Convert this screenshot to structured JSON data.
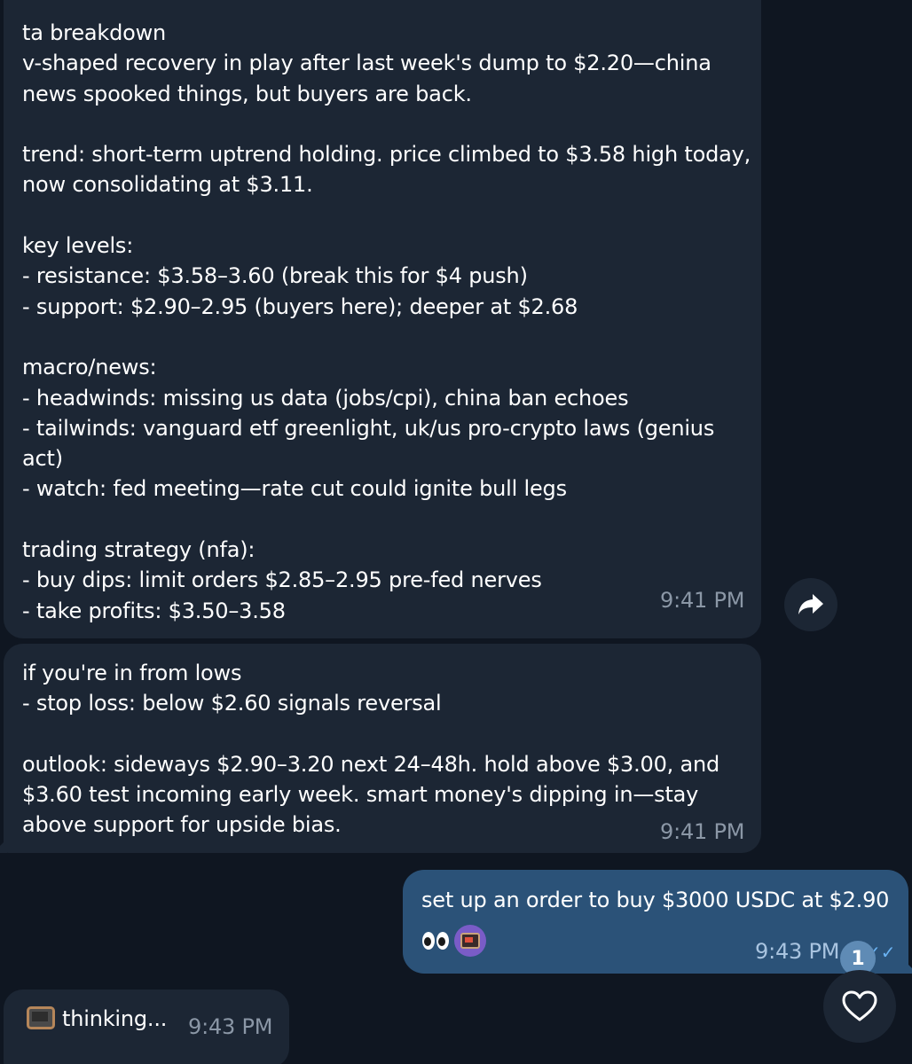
{
  "messages": [
    {
      "text": "ta breakdown\nv-shaped recovery in play after last week's dump to $2.20—china\nnews spooked things, but buyers are back.\n\ntrend: short-term uptrend holding. price climbed to $3.58 high today,\nnow consolidating at $3.11.\n\nkey levels:\n- resistance: $3.58–3.60 (break this for $4 push)\n- support: $2.90–2.95 (buyers here); deeper at $2.68\n\nmacro/news:\n- headwinds: missing us data (jobs/cpi), china ban echoes\n- tailwinds: vanguard etf greenlight, uk/us pro-crypto laws (genius\nact)\n- watch: fed meeting—rate cut could ignite bull legs\n\ntrading strategy (nfa):\n- buy dips: limit orders $2.85–2.95 pre-fed nerves\n- take profits: $3.50–3.58",
      "time": "9:41 PM"
    },
    {
      "text": "if you're in from lows\n- stop loss: below $2.60 signals reversal\n\noutlook: sideways $2.90–3.20 next 24–48h. hold above $3.00, and\n$3.60 test incoming early week. smart money's dipping in—stay\nabove support for upside bias.",
      "time": "9:41 PM"
    },
    {
      "text": "set up an order to buy $3000 USDC at $2.90",
      "time": "9:43 PM",
      "checks": "✓✓"
    },
    {
      "text": "thinking...",
      "time": "9:43 PM"
    }
  ],
  "unread_count": "1",
  "icons": {
    "forward": "forward-arrow-icon",
    "like": "heart-icon",
    "reaction_1": "eyes-emoji",
    "reaction_2": "tv-emoji"
  },
  "colors": {
    "background": "#0f1621",
    "incoming_bubble": "#1c2634",
    "outgoing_bubble": "#2b5278",
    "timestamp": "#8b97a6",
    "badge": "#5f8bb5",
    "check": "#6ab3f3"
  }
}
